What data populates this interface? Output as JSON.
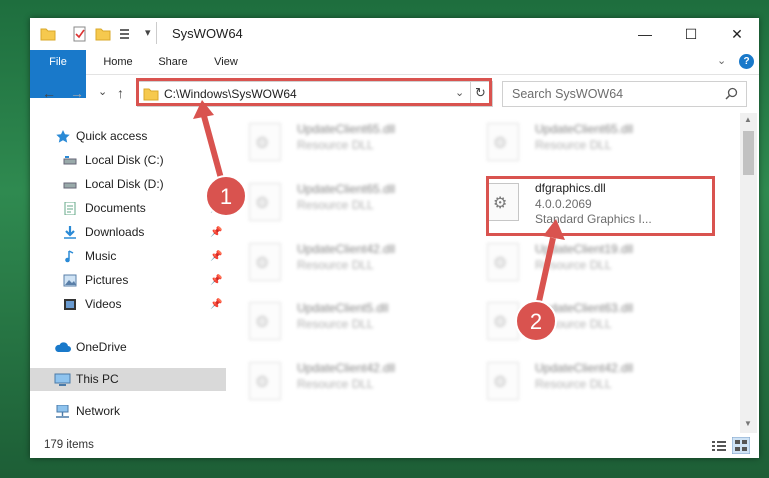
{
  "window": {
    "title": "SysWOW64",
    "controls": {
      "minimize": "—",
      "maximize": "☐",
      "close": "✕"
    }
  },
  "ribbon": {
    "tabs": [
      "File",
      "Home",
      "Share",
      "View"
    ]
  },
  "nav": {
    "back": "←",
    "forward": "→",
    "recent": "⌄",
    "up": "↑",
    "address": "C:\\Windows\\SysWOW64",
    "search_placeholder": "Search SysWOW64"
  },
  "sidebar": {
    "items": [
      {
        "label": "Quick access",
        "icon": "star-icon",
        "pinned": false
      },
      {
        "label": "Local Disk (C:)",
        "icon": "drive-icon",
        "pinned": false
      },
      {
        "label": "Local Disk (D:)",
        "icon": "drive-icon",
        "pinned": false
      },
      {
        "label": "Documents",
        "icon": "documents-icon",
        "pinned": true
      },
      {
        "label": "Downloads",
        "icon": "download-icon",
        "pinned": true
      },
      {
        "label": "Music",
        "icon": "music-icon",
        "pinned": true
      },
      {
        "label": "Pictures",
        "icon": "pictures-icon",
        "pinned": true
      },
      {
        "label": "Videos",
        "icon": "videos-icon",
        "pinned": true
      },
      {
        "label": "OneDrive",
        "icon": "cloud-icon",
        "pinned": false
      },
      {
        "label": "This PC",
        "icon": "computer-icon",
        "pinned": false,
        "selected": true
      },
      {
        "label": "Network",
        "icon": "network-icon",
        "pinned": false
      }
    ]
  },
  "files": {
    "left": [
      {
        "name": "UpdateClient65.dll",
        "desc": "Resource DLL"
      },
      {
        "name": "UpdateClient65.dll",
        "desc": "Resource DLL"
      },
      {
        "name": "UpdateClient42.dll",
        "desc": "Resource DLL"
      },
      {
        "name": "UpdateClient5.dll",
        "desc": "Resource DLL"
      },
      {
        "name": "UpdateClient42.dll",
        "desc": "Resource DLL"
      }
    ],
    "right": [
      {
        "name": "UpdateClient65.dll",
        "desc": "Resource DLL"
      },
      {
        "name": "dfgraphics.dll",
        "desc": "4.0.0.2069",
        "desc2": "Standard Graphics I...",
        "highlighted": true
      },
      {
        "name": "UpdateClient19.dll",
        "desc": "Resource DLL"
      },
      {
        "name": "UpdateClient63.dll",
        "desc": "Resource DLL"
      },
      {
        "name": "UpdateClient42.dll",
        "desc": "Resource DLL"
      }
    ]
  },
  "status": {
    "count": "179 items"
  },
  "annotations": {
    "step1": "1",
    "step2": "2",
    "color": "#d9534f"
  },
  "colors": {
    "accent": "#1979ca",
    "highlight_red": "#d9534f",
    "desktop_green": "#2f8a50"
  }
}
